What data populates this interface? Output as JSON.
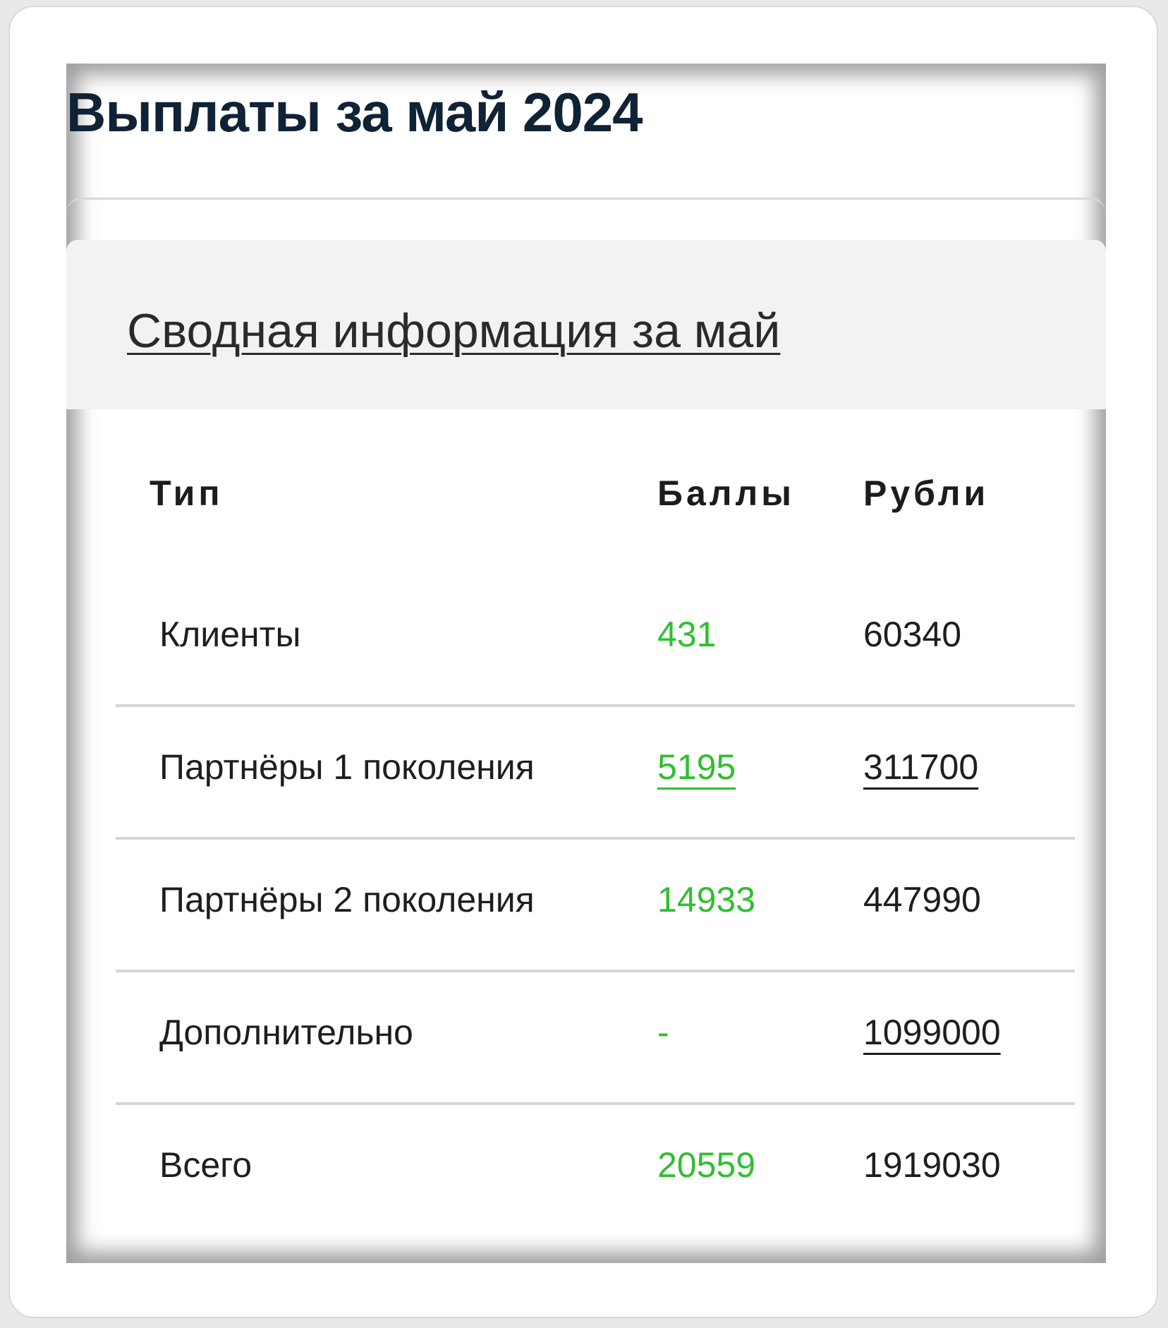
{
  "page_title": "Выплаты за май 2024",
  "summary": {
    "title": "Сводная информация за май",
    "columns": {
      "type": "Тип",
      "points": "Баллы",
      "rubles": "Рубли"
    },
    "rows": [
      {
        "type": "Клиенты",
        "points": "431",
        "rubles": "60340"
      },
      {
        "type": "Партнёры 1 поколения",
        "points": "5195",
        "rubles": "311700"
      },
      {
        "type": "Партнёры 2 поколения",
        "points": "14933",
        "rubles": "447990"
      },
      {
        "type": "Дополнительно",
        "points": "-",
        "rubles": "1099000"
      },
      {
        "type": "Всего",
        "points": "20559",
        "rubles": "1919030"
      }
    ]
  },
  "colors": {
    "points": "#2fbf2f",
    "title": "#0f2236",
    "divider": "#d6d6d6"
  }
}
